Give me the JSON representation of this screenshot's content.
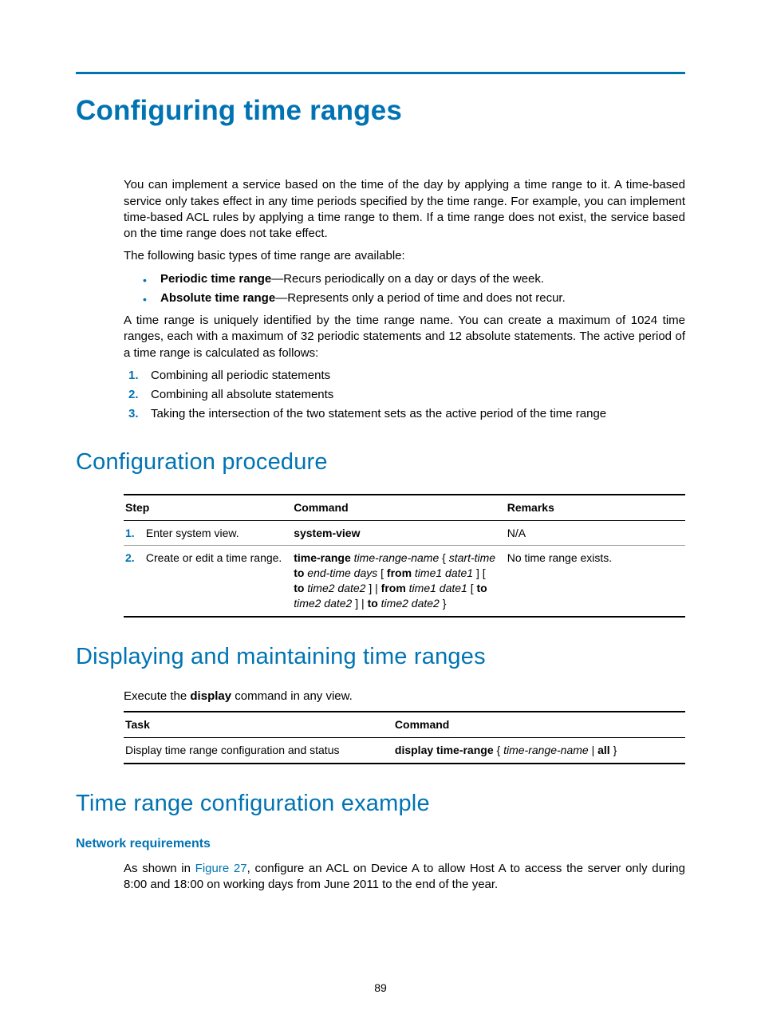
{
  "page_number": "89",
  "title": "Configuring time ranges",
  "intro": {
    "p1": "You can implement a service based on the time of the day by applying a time range to it. A time-based service only takes effect in any time periods specified by the time range. For example, you can implement time-based ACL rules by applying a time range to them. If a time range does not exist, the service based on the time range does not take effect.",
    "p2": "The following basic types of time range are available:",
    "bullets": [
      {
        "term": "Periodic time range",
        "desc": "—Recurs periodically on a day or days of the week."
      },
      {
        "term": "Absolute time range",
        "desc": "—Represents only a period of time and does not recur."
      }
    ],
    "p3": "A time range is uniquely identified by the time range name. You can create a maximum of 1024 time ranges, each with a maximum of 32 periodic statements and 12 absolute statements. The active period of a time range is calculated as follows:",
    "steps": [
      "Combining all periodic statements",
      "Combining all absolute statements",
      "Taking the intersection of the two statement sets as the active period of the time range"
    ]
  },
  "config_procedure": {
    "heading": "Configuration procedure",
    "headers": {
      "step": "Step",
      "command": "Command",
      "remarks": "Remarks"
    },
    "rows": [
      {
        "num": "1.",
        "step": "Enter system view.",
        "command_bold": "system-view",
        "command_rest": "",
        "remarks": "N/A"
      },
      {
        "num": "2.",
        "step": "Create or edit a time range.",
        "command_bold": "time-range",
        "command_rest_html": true,
        "remarks": "No time range exists."
      }
    ],
    "row2_command": {
      "part1_italic": " time-range-name ",
      "brace_open": "{ ",
      "start_time_italic": "start-time ",
      "to1": "to",
      "end_time_italic": " end-time days ",
      "lb1": "[ ",
      "from1": "from",
      "time1_italic": " time1 date1 ",
      "rb1": "] [ ",
      "to2": "to",
      "time2_italic": " time2 date2 ",
      "rb2": "] | ",
      "from2": "from",
      "time1b_italic": " time1 date1 ",
      "lb2": "[ ",
      "to3": "to",
      "time2b_italic": " time2 date2 ",
      "rb3": "] | ",
      "to4": "to",
      "time2c_italic": " time2 date2 ",
      "brace_close": "}"
    }
  },
  "display_maintain": {
    "heading": "Displaying and maintaining time ranges",
    "p1_pre": "Execute the ",
    "p1_bold": "display",
    "p1_post": " command in any view.",
    "headers": {
      "task": "Task",
      "command": "Command"
    },
    "row": {
      "task": "Display time range configuration and status",
      "cmd_bold": "display time-range",
      "cmd_rest_open": " { ",
      "cmd_italic": "time-range-name",
      "cmd_pipe": " | ",
      "cmd_all": "all",
      "cmd_close": " }"
    }
  },
  "example": {
    "heading": "Time range configuration example",
    "subheading": "Network requirements",
    "p1_pre": "As shown in ",
    "p1_link": "Figure 27",
    "p1_post": ", configure an ACL on Device A to allow Host A to access the server only during 8:00 and 18:00 on working days from June 2011 to the end of the year."
  }
}
